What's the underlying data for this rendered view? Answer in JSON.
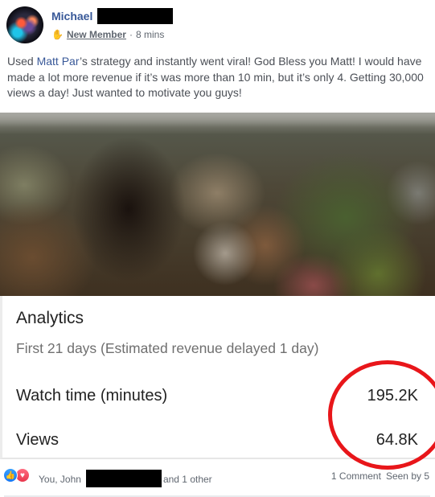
{
  "post": {
    "author_first_name": "Michael",
    "author_last_name_redacted": true,
    "badge_icon": "wave-hand-icon",
    "badge": "New Member",
    "separator": "·",
    "time": "8 mins",
    "text_before_mention": "Used ",
    "mention": "Matt Par",
    "text_after_mention": "’s strategy and instantly went viral! God Bless you Matt! I would have made a lot more revenue if it’s was more than 10 min, but it’s only 4. Getting 30,000 views a day! Just wanted to motivate you guys!"
  },
  "analytics": {
    "title": "Analytics",
    "subtitle": "First 21 days (Estimated revenue delayed 1 day)",
    "rows": [
      {
        "label": "Watch time (minutes)",
        "value": "195.2K"
      },
      {
        "label": "Views",
        "value": "64.8K"
      }
    ],
    "highlight_color": "#e8161a"
  },
  "reactions": {
    "icons": [
      "like-icon",
      "love-icon"
    ],
    "like_glyph": "👍",
    "love_glyph": "♥",
    "names_prefix": "You, John",
    "names_suffix": "and 1 other",
    "comments": "1 Comment",
    "seen_by": "Seen by 5"
  },
  "colors": {
    "link": "#385898",
    "meta": "#606770",
    "like": "#1877f2",
    "love": "#e8364c"
  }
}
